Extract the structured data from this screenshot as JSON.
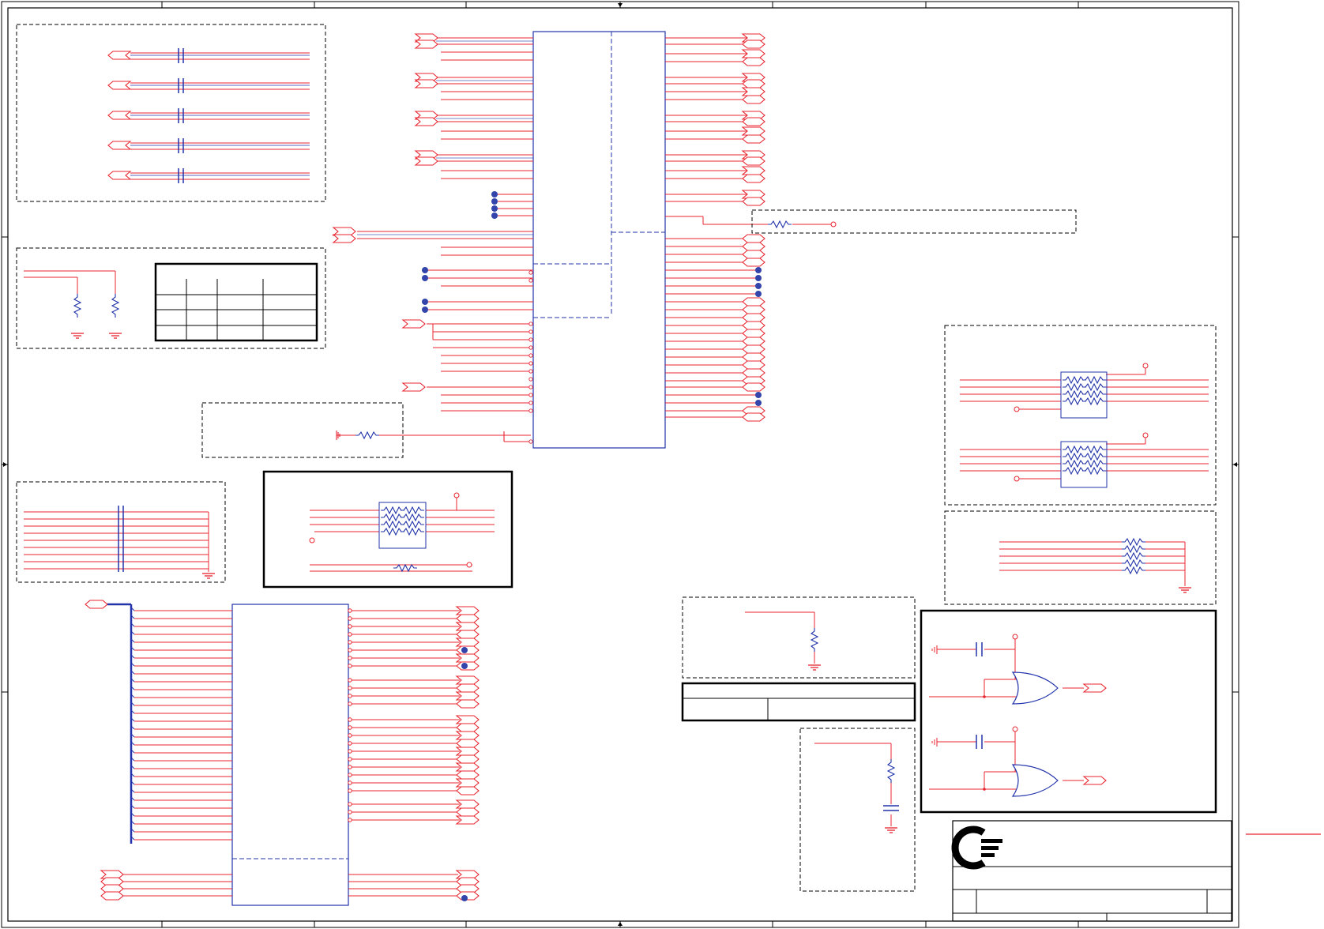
{
  "sheet": {
    "title": "",
    "page_number": "",
    "revision": ""
  },
  "colors": {
    "wire": "#e8242f",
    "component": "#2233aa",
    "frame": "#000000",
    "junction": "#3344aa",
    "dashed_box": "#000000"
  },
  "logo": {
    "icon": "company-logo-icon"
  },
  "components": {
    "main_ic_top": "fpga-connector-top",
    "main_ic_bottom": "fpga-connector-bottom",
    "or_gates": [
      "or-gate-icon",
      "or-gate-icon"
    ],
    "resistor_networks": 5,
    "ground_symbols": 9
  }
}
